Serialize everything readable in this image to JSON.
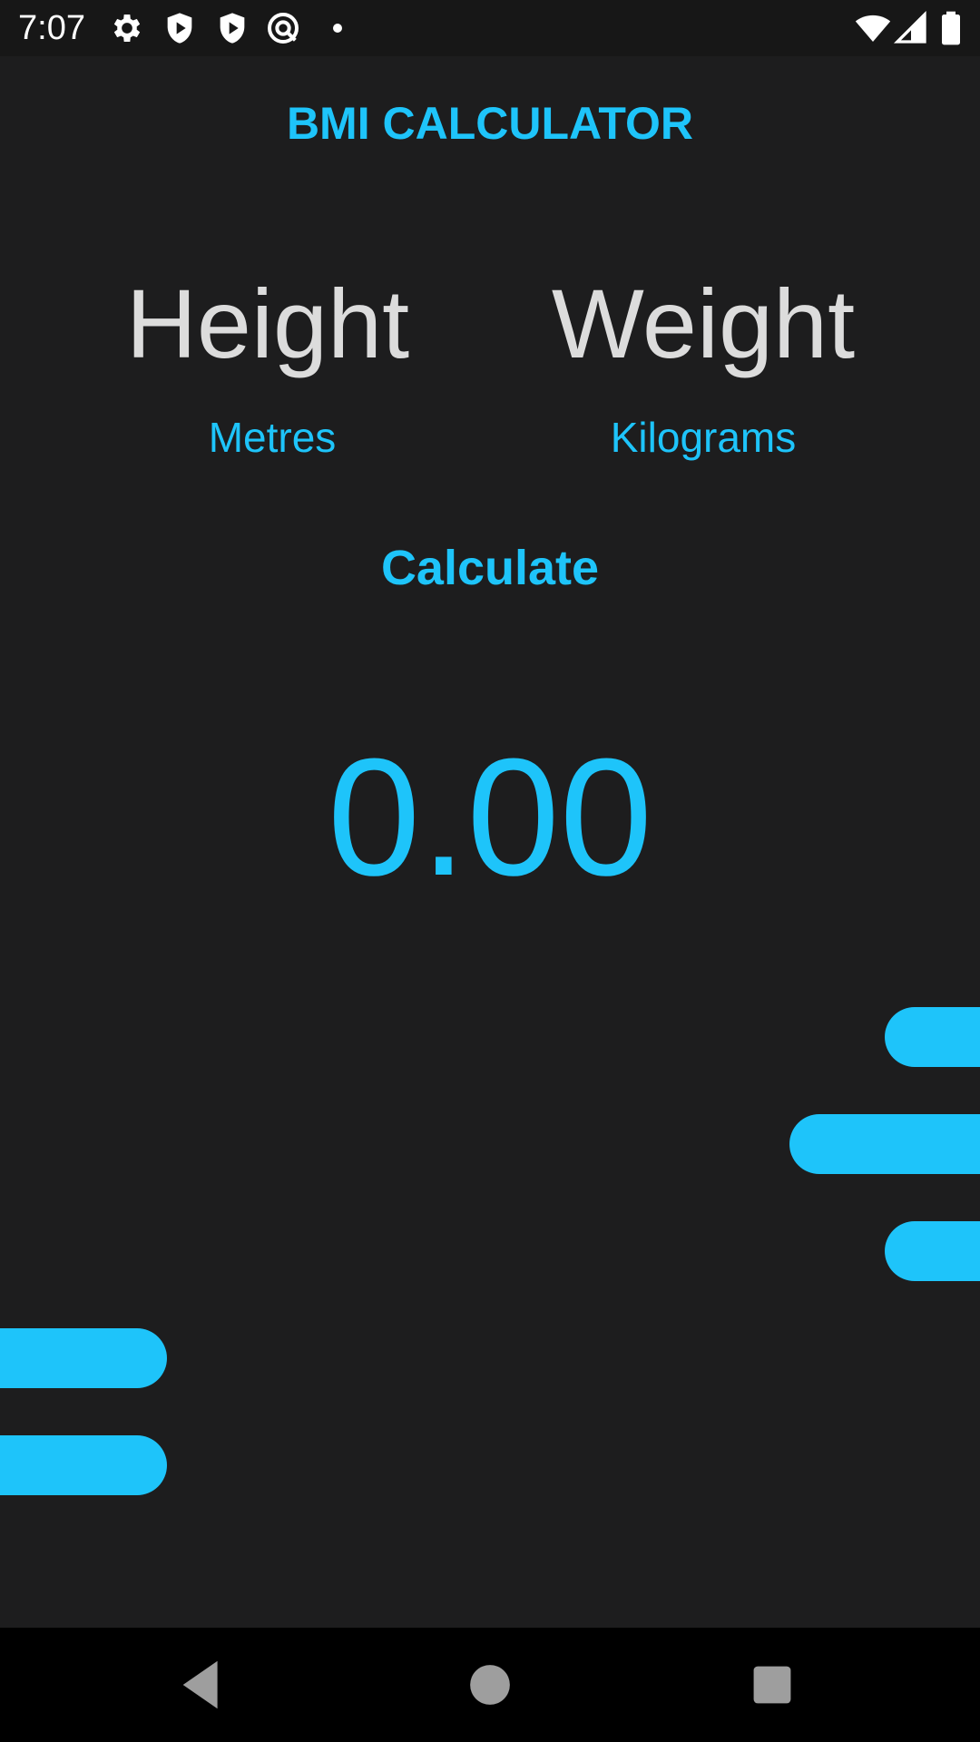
{
  "status_bar": {
    "time": "7:07",
    "left_icons": [
      "gear-icon",
      "shield-play-icon",
      "shield-play-icon",
      "at-sync-icon",
      "dot-icon"
    ],
    "right_icons": [
      "wifi-icon",
      "cell-signal-icon",
      "battery-icon"
    ]
  },
  "app": {
    "title": "BMI CALCULATOR",
    "height": {
      "label": "Height",
      "placeholder": "Metres"
    },
    "weight": {
      "label": "Weight",
      "placeholder": "Kilograms"
    },
    "calculate_label": "Calculate",
    "result": "0.00"
  },
  "colors": {
    "accent": "#1ec4fa",
    "background": "#1d1d1e",
    "label_text": "#dcdcdc"
  },
  "nav_bar": {
    "buttons": [
      "back-icon",
      "home-icon",
      "recents-icon"
    ]
  }
}
